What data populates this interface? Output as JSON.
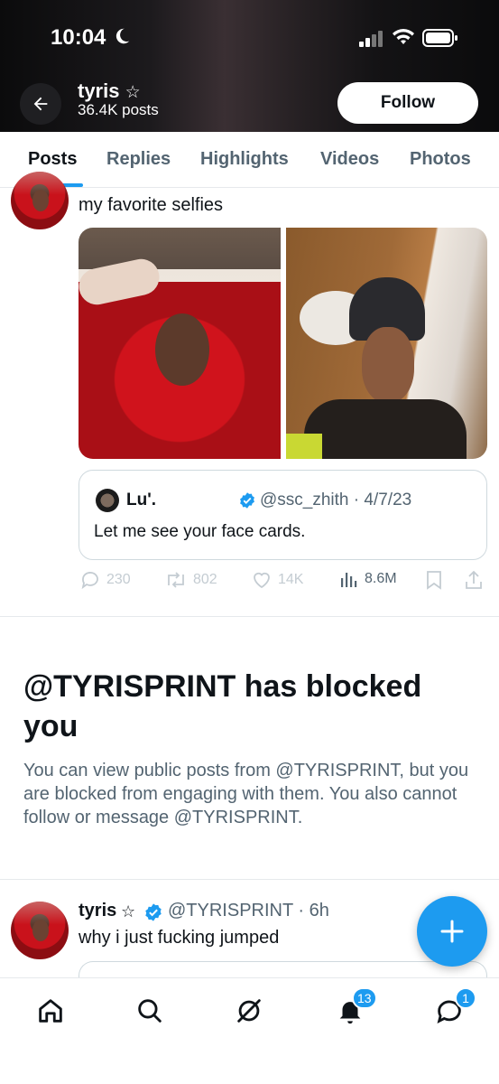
{
  "status_bar": {
    "time": "10:04"
  },
  "header": {
    "name": "tyris",
    "star": "☆",
    "post_count": "36.4K posts",
    "follow_label": "Follow"
  },
  "tabs": [
    {
      "label": "Posts",
      "active": true
    },
    {
      "label": "Replies"
    },
    {
      "label": "Highlights"
    },
    {
      "label": "Videos"
    },
    {
      "label": "Photos"
    }
  ],
  "post1": {
    "text": "my favorite selfies",
    "quote": {
      "name": "Lu'.",
      "handle": "@ssc_zhith · 4/7/23",
      "text": "Let me see your face cards."
    },
    "actions": {
      "replies": "230",
      "reposts": "802",
      "likes": "14K",
      "views": "8.6M"
    }
  },
  "blocked": {
    "title": "@TYRISPRINT has blocked you",
    "body": "You can view public posts from @TYRISPRINT, but you are blocked from engaging with them. You also cannot follow or message @TYRISPRINT."
  },
  "post2": {
    "name": "tyris",
    "star": "☆",
    "handle": "@TYRISPRINT · 6h",
    "text": "why i just fucking jumped"
  },
  "bottom_nav": {
    "notifications_badge": "13",
    "messages_badge": "1"
  },
  "colors": {
    "accent": "#1d9bf0",
    "text": "#0f1419",
    "muted": "#536471"
  }
}
